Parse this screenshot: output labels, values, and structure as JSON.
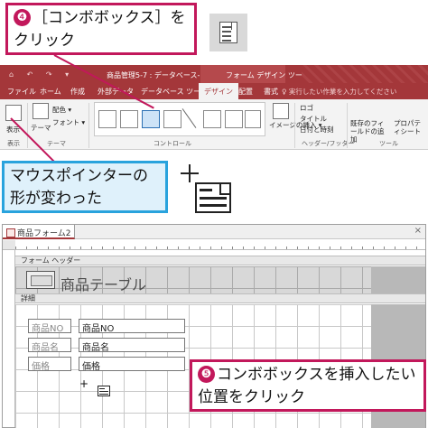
{
  "callout_step4": {
    "number": "❹",
    "line1": "［コンボボックス］を",
    "line2": "クリック"
  },
  "callout_pointer": {
    "line1": "マウスポインターの",
    "line2": "形が変わった"
  },
  "callout_step5": {
    "number": "❺",
    "line1": "コンボボックスを挿入したい",
    "line2": "位置をクリック"
  },
  "titlebar": {
    "document_title": "商品管理5-7 : データベース- C:¥Users¥…",
    "context_tab": "フォーム デザイン ツール",
    "quick_access": "⌂ ↶ ↷ ▾"
  },
  "ribbon_tabs": [
    "ファイル",
    "ホーム",
    "作成",
    "外部データ",
    "データベース ツール",
    "デザイン",
    "配置",
    "書式"
  ],
  "active_tab": "デザイン",
  "tell_me_placeholder": "♀ 実行したい作業を入力してください",
  "ribbon_groups": {
    "view": {
      "label": "表示",
      "button": "表示"
    },
    "theme": {
      "label": "テーマ",
      "theme_button": "テーマ",
      "color": "配色 ▾",
      "font": "フォント ▾"
    },
    "controls": {
      "label": "コントロール",
      "insert_image": "イメージの挿入 ▾"
    },
    "header_footer": {
      "label": "ヘッダー/フッター",
      "logo": "ロゴ",
      "title": "タイトル",
      "datetime": "日付と時刻"
    },
    "tools": {
      "label": "ツール",
      "add_fields": "既存のフィールドの追加",
      "property_sheet": "プロパティシート"
    }
  },
  "form_window": {
    "tab_title": "商品フォーム2",
    "close": "×",
    "form_header_label": "フォーム ヘッダー",
    "detail_label": "詳細",
    "header_title": "商品テーブル",
    "fields": [
      {
        "label": "商品NO",
        "value": "商品NO"
      },
      {
        "label": "商品名",
        "value": "商品名"
      },
      {
        "label": "価格",
        "value": "価格"
      }
    ]
  },
  "colors": {
    "accent_pink": "#c2185b",
    "callout_blue": "#29a3dd",
    "access_red": "#a4373a"
  }
}
